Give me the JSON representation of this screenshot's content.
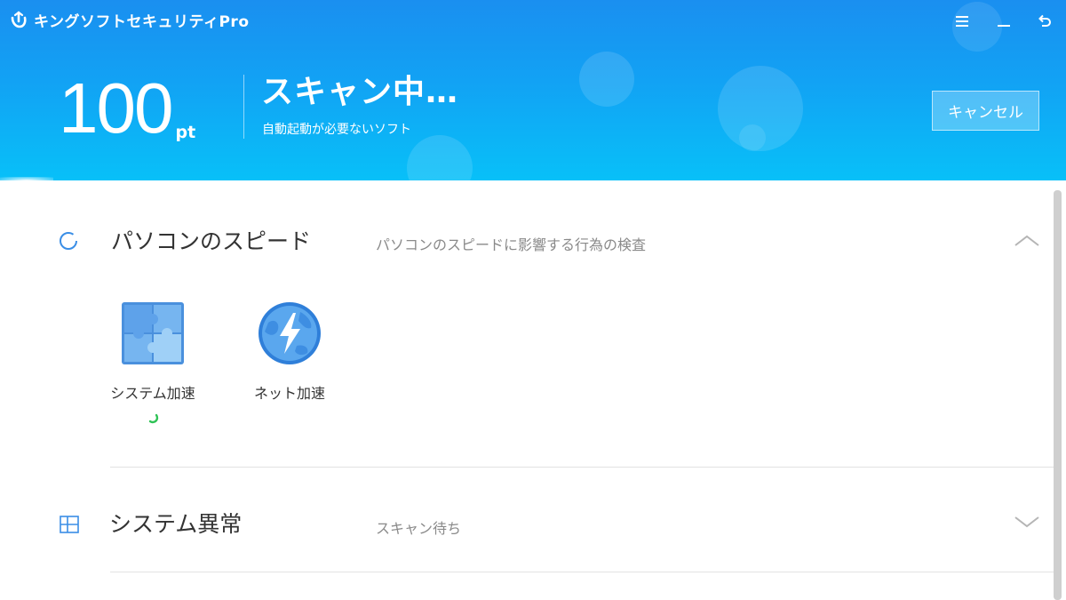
{
  "app": {
    "title": "キングソフトセキュリティPro"
  },
  "window_controls": {
    "menu": "menu-icon",
    "minimize": "minimize-icon",
    "back": "back-icon"
  },
  "header": {
    "score_value": "100",
    "score_unit": "pt",
    "status_title": "スキャン中…",
    "status_subtitle": "自動起動が必要ないソフト",
    "cancel_label": "キャンセル"
  },
  "sections": [
    {
      "title": "パソコンのスピード",
      "description": "パソコンのスピードに影響する行為の検査",
      "expanded": true,
      "icon": "circle-icon",
      "items": [
        {
          "label": "システム加速",
          "icon": "puzzle-icon",
          "scanning": true
        },
        {
          "label": "ネット加速",
          "icon": "globe-lightning-icon",
          "scanning": false
        }
      ]
    },
    {
      "title": "システム異常",
      "description": "スキャン待ち",
      "expanded": false,
      "icon": "windows-icon"
    }
  ],
  "colors": {
    "header_top": "#1a8ff0",
    "header_bottom": "#08c0f8",
    "accent_blue": "#3a8ee6",
    "spinner_green": "#2ec255"
  }
}
